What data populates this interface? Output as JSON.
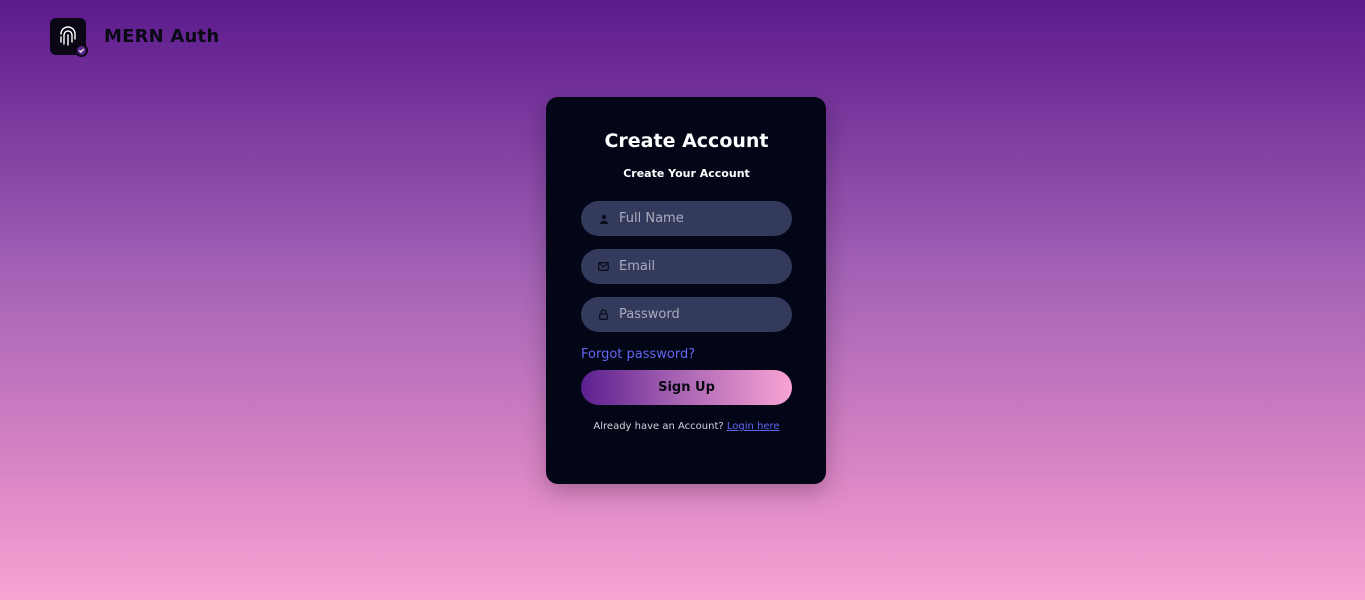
{
  "header": {
    "brand_name": "MERN Auth",
    "logo_icon": "fingerprint-check-icon"
  },
  "card": {
    "title": "Create Account",
    "subtitle": "Create Your Account",
    "fields": [
      {
        "icon": "user-icon",
        "placeholder": "Full Name",
        "value": ""
      },
      {
        "icon": "mail-icon",
        "placeholder": "Email",
        "value": ""
      },
      {
        "icon": "lock-icon",
        "placeholder": "Password",
        "value": ""
      }
    ],
    "forgot_label": "Forgot password?",
    "submit_label": "Sign Up",
    "footer_text": "Already have an Account?",
    "login_link": "Login here"
  },
  "colors": {
    "background_top": "#5b1a8c",
    "background_bottom": "#f9a3d4",
    "card_bg": "#020617",
    "input_bg": "#333a5b",
    "link": "#6366f1"
  }
}
